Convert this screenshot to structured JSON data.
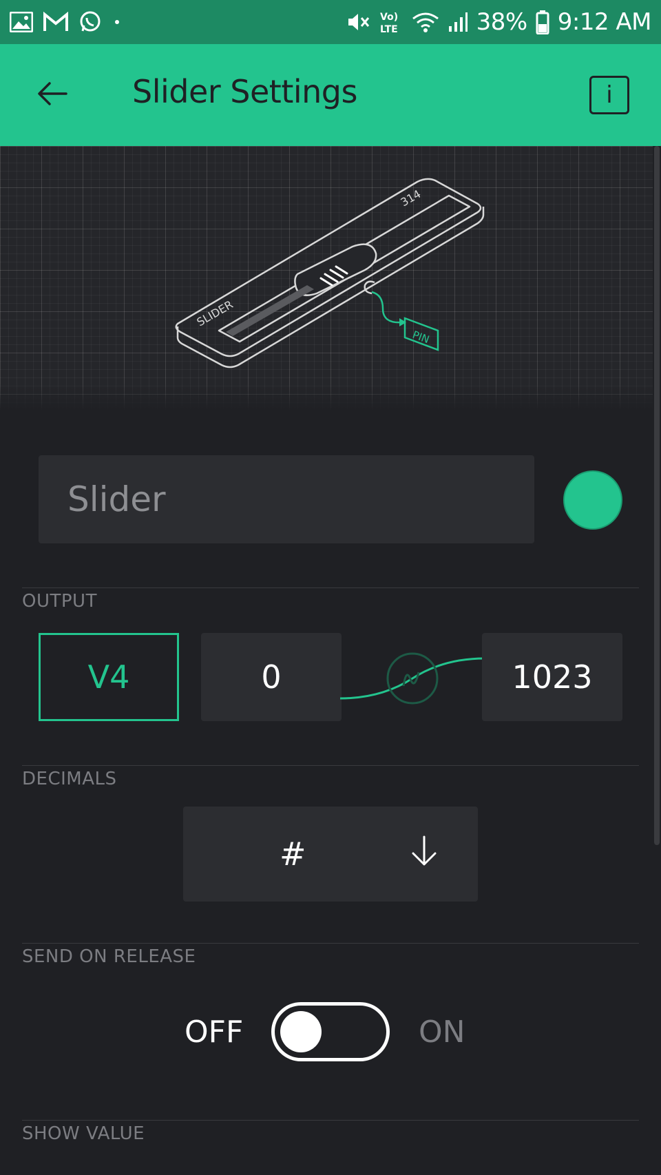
{
  "status_bar": {
    "battery_percent": "38%",
    "time": "9:12 AM",
    "network_label": "Vo) LTE",
    "left_icons": [
      "gallery-icon",
      "gmail-icon",
      "whatsapp-icon",
      "dot-icon"
    ],
    "right_icons": [
      "mute-icon",
      "volte-icon",
      "wifi-icon",
      "signal-icon",
      "battery-icon"
    ]
  },
  "app_bar": {
    "title": "Slider Settings",
    "info_label": "i",
    "back_icon": "arrow-left-icon"
  },
  "hero": {
    "illustration_label": "SLIDER",
    "illustration_value": "314",
    "illustration_pin": "PIN"
  },
  "name_field": {
    "value": "Slider",
    "color": "#23c48e"
  },
  "output": {
    "label": "OUTPUT",
    "pin": "V4",
    "min": "0",
    "max": "1023"
  },
  "decimals": {
    "label": "DECIMALS",
    "value": "#"
  },
  "send_on_release": {
    "label": "SEND ON RELEASE",
    "off_label": "OFF",
    "on_label": "ON",
    "state": "off"
  },
  "show_value": {
    "label": "SHOW VALUE"
  },
  "colors": {
    "accent": "#23c48e",
    "status_bar": "#1d8a63",
    "background": "#1f2024",
    "field": "#2c2d31"
  }
}
